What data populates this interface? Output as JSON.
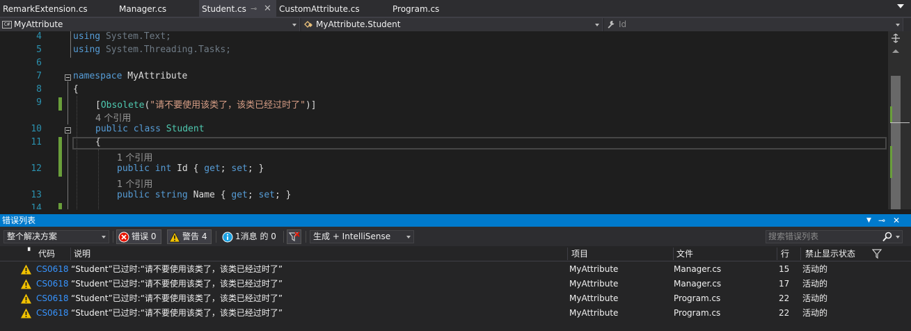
{
  "tabs": [
    {
      "label": "RemarkExtension.cs",
      "active": false
    },
    {
      "label": "Manager.cs",
      "active": false
    },
    {
      "label": "Student.cs",
      "active": true
    },
    {
      "label": "CustomAttribute.cs",
      "active": false
    },
    {
      "label": "Program.cs",
      "active": false
    }
  ],
  "nav": {
    "project": "MyAttribute",
    "type": "MyAttribute.Student",
    "member": "Id"
  },
  "editor": {
    "line_numbers": [
      "4",
      "5",
      "6",
      "7",
      "8",
      "9",
      "10",
      "11",
      "12",
      "13",
      "14"
    ],
    "lines": {
      "l4_kw": "using",
      "l4_rest": " System.Text;",
      "l5_kw": "using",
      "l5_rest": " System.Threading.Tasks;",
      "l7_kw": "namespace",
      "l7_rest": " MyAttribute",
      "l8": "{",
      "l9_open": "[",
      "l9_attr": "Obsolete",
      "l9_paren": "(",
      "l9_str": "\"请不要使用该类了，该类已经过时了\"",
      "l9_close": ")]",
      "l10_kw": "public class",
      "l10_type": "Student",
      "l11": "{",
      "l12_kw1": "public int",
      "l12_name": " Id { ",
      "l12_get": "get",
      "l12_semi1": "; ",
      "l12_set": "set",
      "l12_end": "; }",
      "l13_kw1": "public string",
      "l13_name": " Name { ",
      "l13_get": "get",
      "l13_semi1": "; ",
      "l13_set": "set",
      "l13_end": "; }"
    },
    "codelens": {
      "class_refs": "4 个引用",
      "id_refs": "1 个引用",
      "name_refs": "1 个引用"
    }
  },
  "error_list": {
    "title": "错误列表",
    "scope": "整个解决方案",
    "errors_label": "错误 0",
    "warnings_label": "警告 4",
    "messages_label": "1消息 的 0",
    "build_filter": "生成 + IntelliSense",
    "search_placeholder": "搜索错误列表",
    "columns": {
      "code": "代码",
      "description": "说明",
      "project": "项目",
      "file": "文件",
      "line": "行",
      "suppression": "禁止显示状态"
    },
    "rows": [
      {
        "code": "CS0618",
        "description": "“Student”已过时:“请不要使用该类了，该类已经过时了”",
        "project": "MyAttribute",
        "file": "Manager.cs",
        "line": "15",
        "suppression": "活动的"
      },
      {
        "code": "CS0618",
        "description": "“Student”已过时:“请不要使用该类了，该类已经过时了”",
        "project": "MyAttribute",
        "file": "Manager.cs",
        "line": "17",
        "suppression": "活动的"
      },
      {
        "code": "CS0618",
        "description": "“Student”已过时:“请不要使用该类了，该类已经过时了”",
        "project": "MyAttribute",
        "file": "Program.cs",
        "line": "22",
        "suppression": "活动的"
      },
      {
        "code": "CS0618",
        "description": "“Student”已过时:“请不要使用该类了，该类已经过时了”",
        "project": "MyAttribute",
        "file": "Program.cs",
        "line": "22",
        "suppression": "活动的"
      }
    ]
  },
  "colors": {
    "accent": "#007acc",
    "keyword": "#569cd6",
    "type": "#4ec9b0",
    "string": "#d69d85",
    "line_number": "#2b91af",
    "warning": "#f2c200",
    "error": "#e51400",
    "change_bar": "#6a9f3b"
  }
}
